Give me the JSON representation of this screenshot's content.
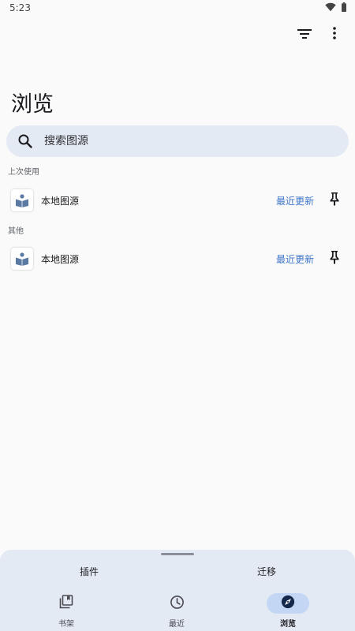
{
  "status_bar": {
    "time": "5:23",
    "icons": [
      "wifi-icon",
      "battery-icon"
    ]
  },
  "top_bar": {
    "actions": [
      "filter-icon",
      "more-vert-icon"
    ]
  },
  "page": {
    "title": "浏览"
  },
  "search": {
    "placeholder": "搜索图源",
    "value": ""
  },
  "sections": [
    {
      "header": "上次使用",
      "items": [
        {
          "name": "本地图源",
          "latest_label": "最近更新",
          "icon": "local-source-logo"
        }
      ]
    },
    {
      "header": "其他",
      "items": [
        {
          "name": "本地图源",
          "latest_label": "最近更新",
          "icon": "local-source-logo"
        }
      ]
    }
  ],
  "bottom_sheet": {
    "tabs": [
      "插件",
      "迁移"
    ]
  },
  "bottom_nav": {
    "items": [
      {
        "label": "书架",
        "icon": "library-icon",
        "active": false
      },
      {
        "label": "最近",
        "icon": "history-icon",
        "active": false
      },
      {
        "label": "浏览",
        "icon": "explore-icon",
        "active": true
      }
    ]
  },
  "colors": {
    "accent": "#3d76c9",
    "surface_variant": "#e4eaf4",
    "active_pill": "#c3d6f4",
    "logo_blue": "#5a7aa3"
  }
}
